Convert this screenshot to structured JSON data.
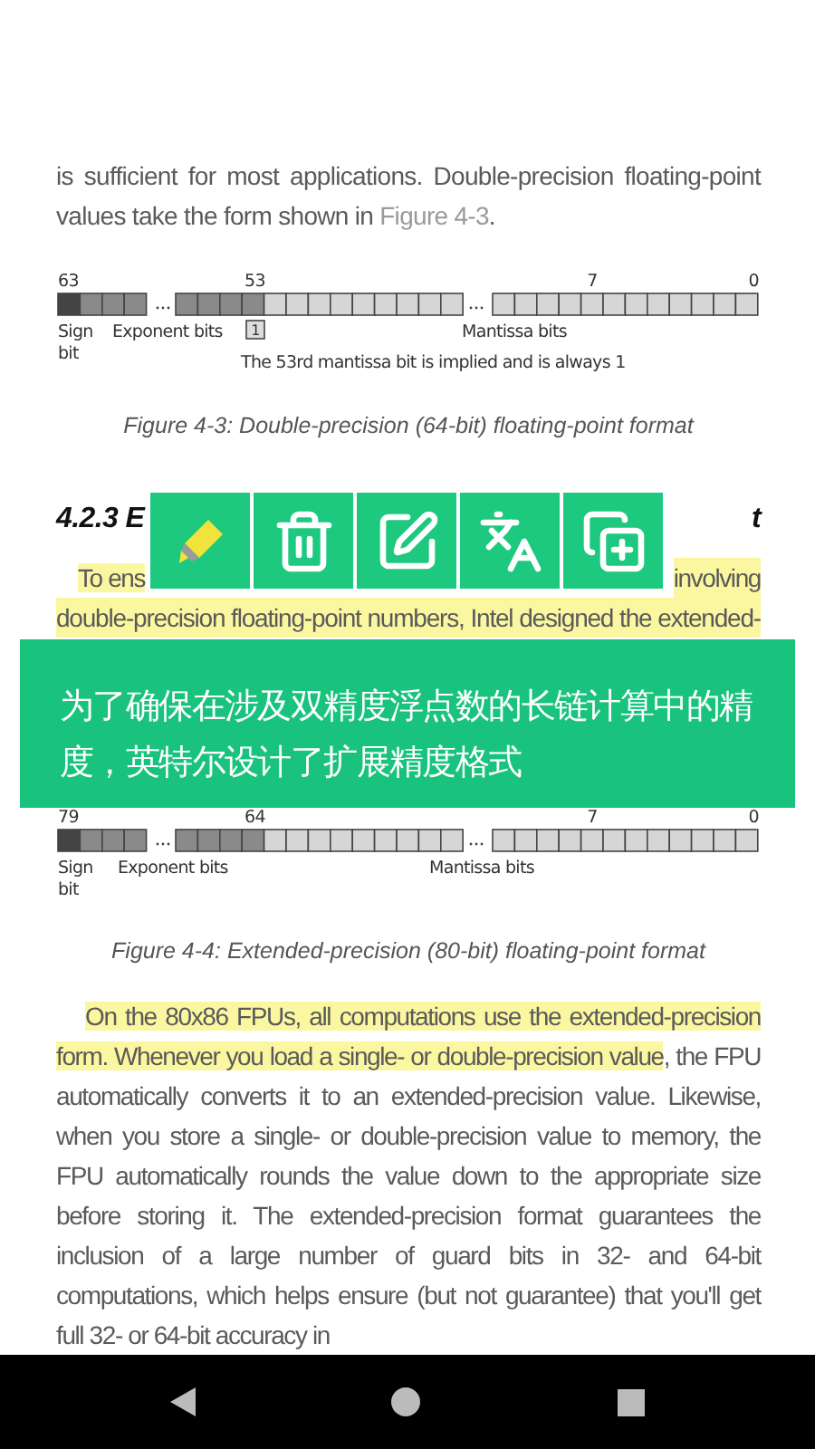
{
  "paragraph_1": {
    "text": "is sufficient for most applications. Double-precision floating-point values take the form shown in",
    "link": "Figure 4-3",
    "tail": "."
  },
  "figures": [
    {
      "bit_numbers": [
        "63",
        "53",
        "7",
        "0"
      ],
      "sign_label": "Sign",
      "sign_label_2": "bit",
      "exponent_label": "Exponent bits",
      "implied_bit": "1",
      "mantissa_label": "Mantissa bits",
      "implied_note": "The 53rd mantissa bit is implied and is always 1",
      "caption": "Figure 4-3: Double-precision (64-bit) floating-point format"
    },
    {
      "bit_numbers": [
        "79",
        "64",
        "7",
        "0"
      ],
      "sign_label": "Sign",
      "sign_label_2": "bit",
      "exponent_label": "Exponent bits",
      "mantissa_label": "Mantissa bits",
      "caption": "Figure 4-4: Extended-precision (80-bit) floating-point format"
    }
  ],
  "section_heading": {
    "visible_start": "4.2.3 E",
    "visible_end": "t"
  },
  "paragraph_2": {
    "line_1_start": "To ens",
    "line_1_end": "involving",
    "line_2": "double-precision floating-point numbers, Intel designed the extended-"
  },
  "toolbar": [
    {
      "kind": "highlight"
    },
    {
      "kind": "delete"
    },
    {
      "kind": "edit"
    },
    {
      "kind": "translate"
    },
    {
      "kind": "copy"
    }
  ],
  "translation": "为了确保在涉及双精度浮点数的长链计算中的精度，英特尔设计了扩展精度格式",
  "paragraph_3": {
    "highlighted": "On the 80x86 FPUs, all computations use the extended-precision form. Whenever you load a single- or double-precision value",
    "rest": ", the FPU automatically converts it to an extended-precision value. Likewise, when you store a single- or double-precision value to memory, the FPU automatically rounds the value down to the appropriate size before storing it. The extended-precision format guarantees the inclusion of a large number of guard bits in 32- and 64-bit computations, which helps ensure (but not guarantee) that you'll get full 32- or 64-bit accuracy in"
  },
  "nav_bar": [
    {
      "kind": "back"
    },
    {
      "kind": "home"
    },
    {
      "kind": "recents"
    }
  ]
}
